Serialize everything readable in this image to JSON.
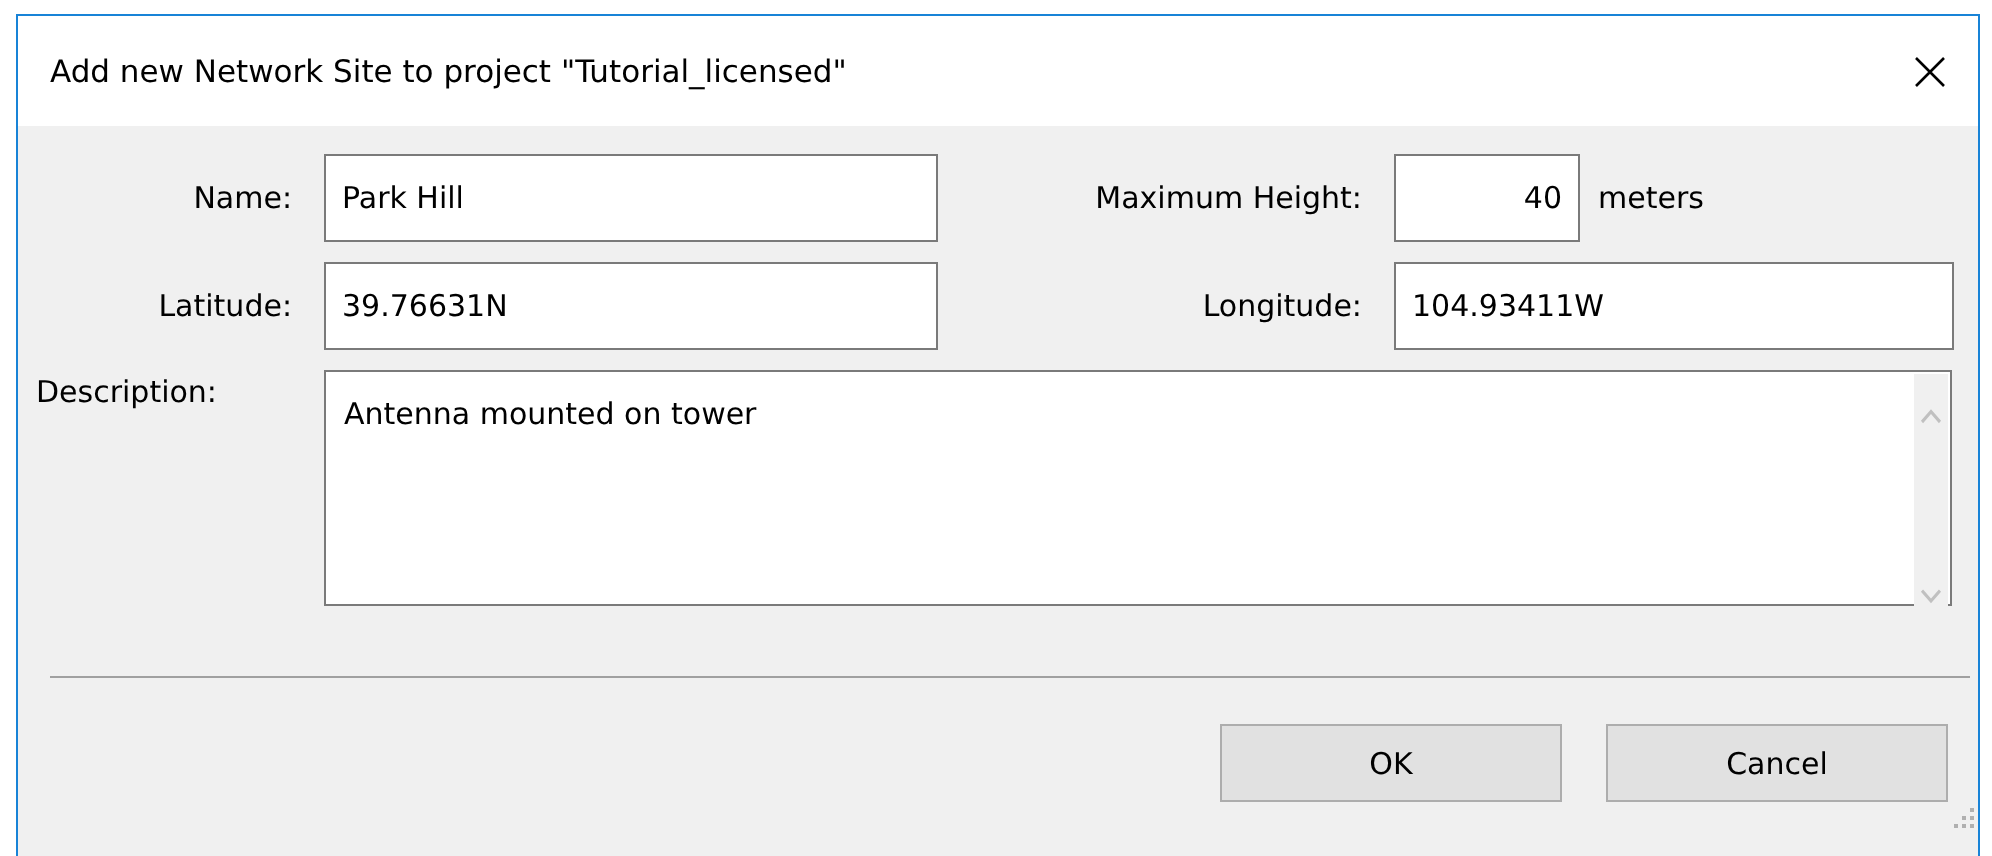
{
  "window": {
    "title": "Add new Network Site to project \"Tutorial_licensed\""
  },
  "name": {
    "label": "Name:",
    "value": "Park Hill"
  },
  "max_height": {
    "label": "Maximum Height:",
    "value": "40",
    "unit": "meters"
  },
  "latitude": {
    "label": "Latitude:",
    "value": "39.76631N"
  },
  "longitude": {
    "label": "Longitude:",
    "value": "104.93411W"
  },
  "description": {
    "label": "Description:",
    "value": "Antenna mounted on tower"
  },
  "buttons": [
    "OK",
    "Cancel"
  ]
}
